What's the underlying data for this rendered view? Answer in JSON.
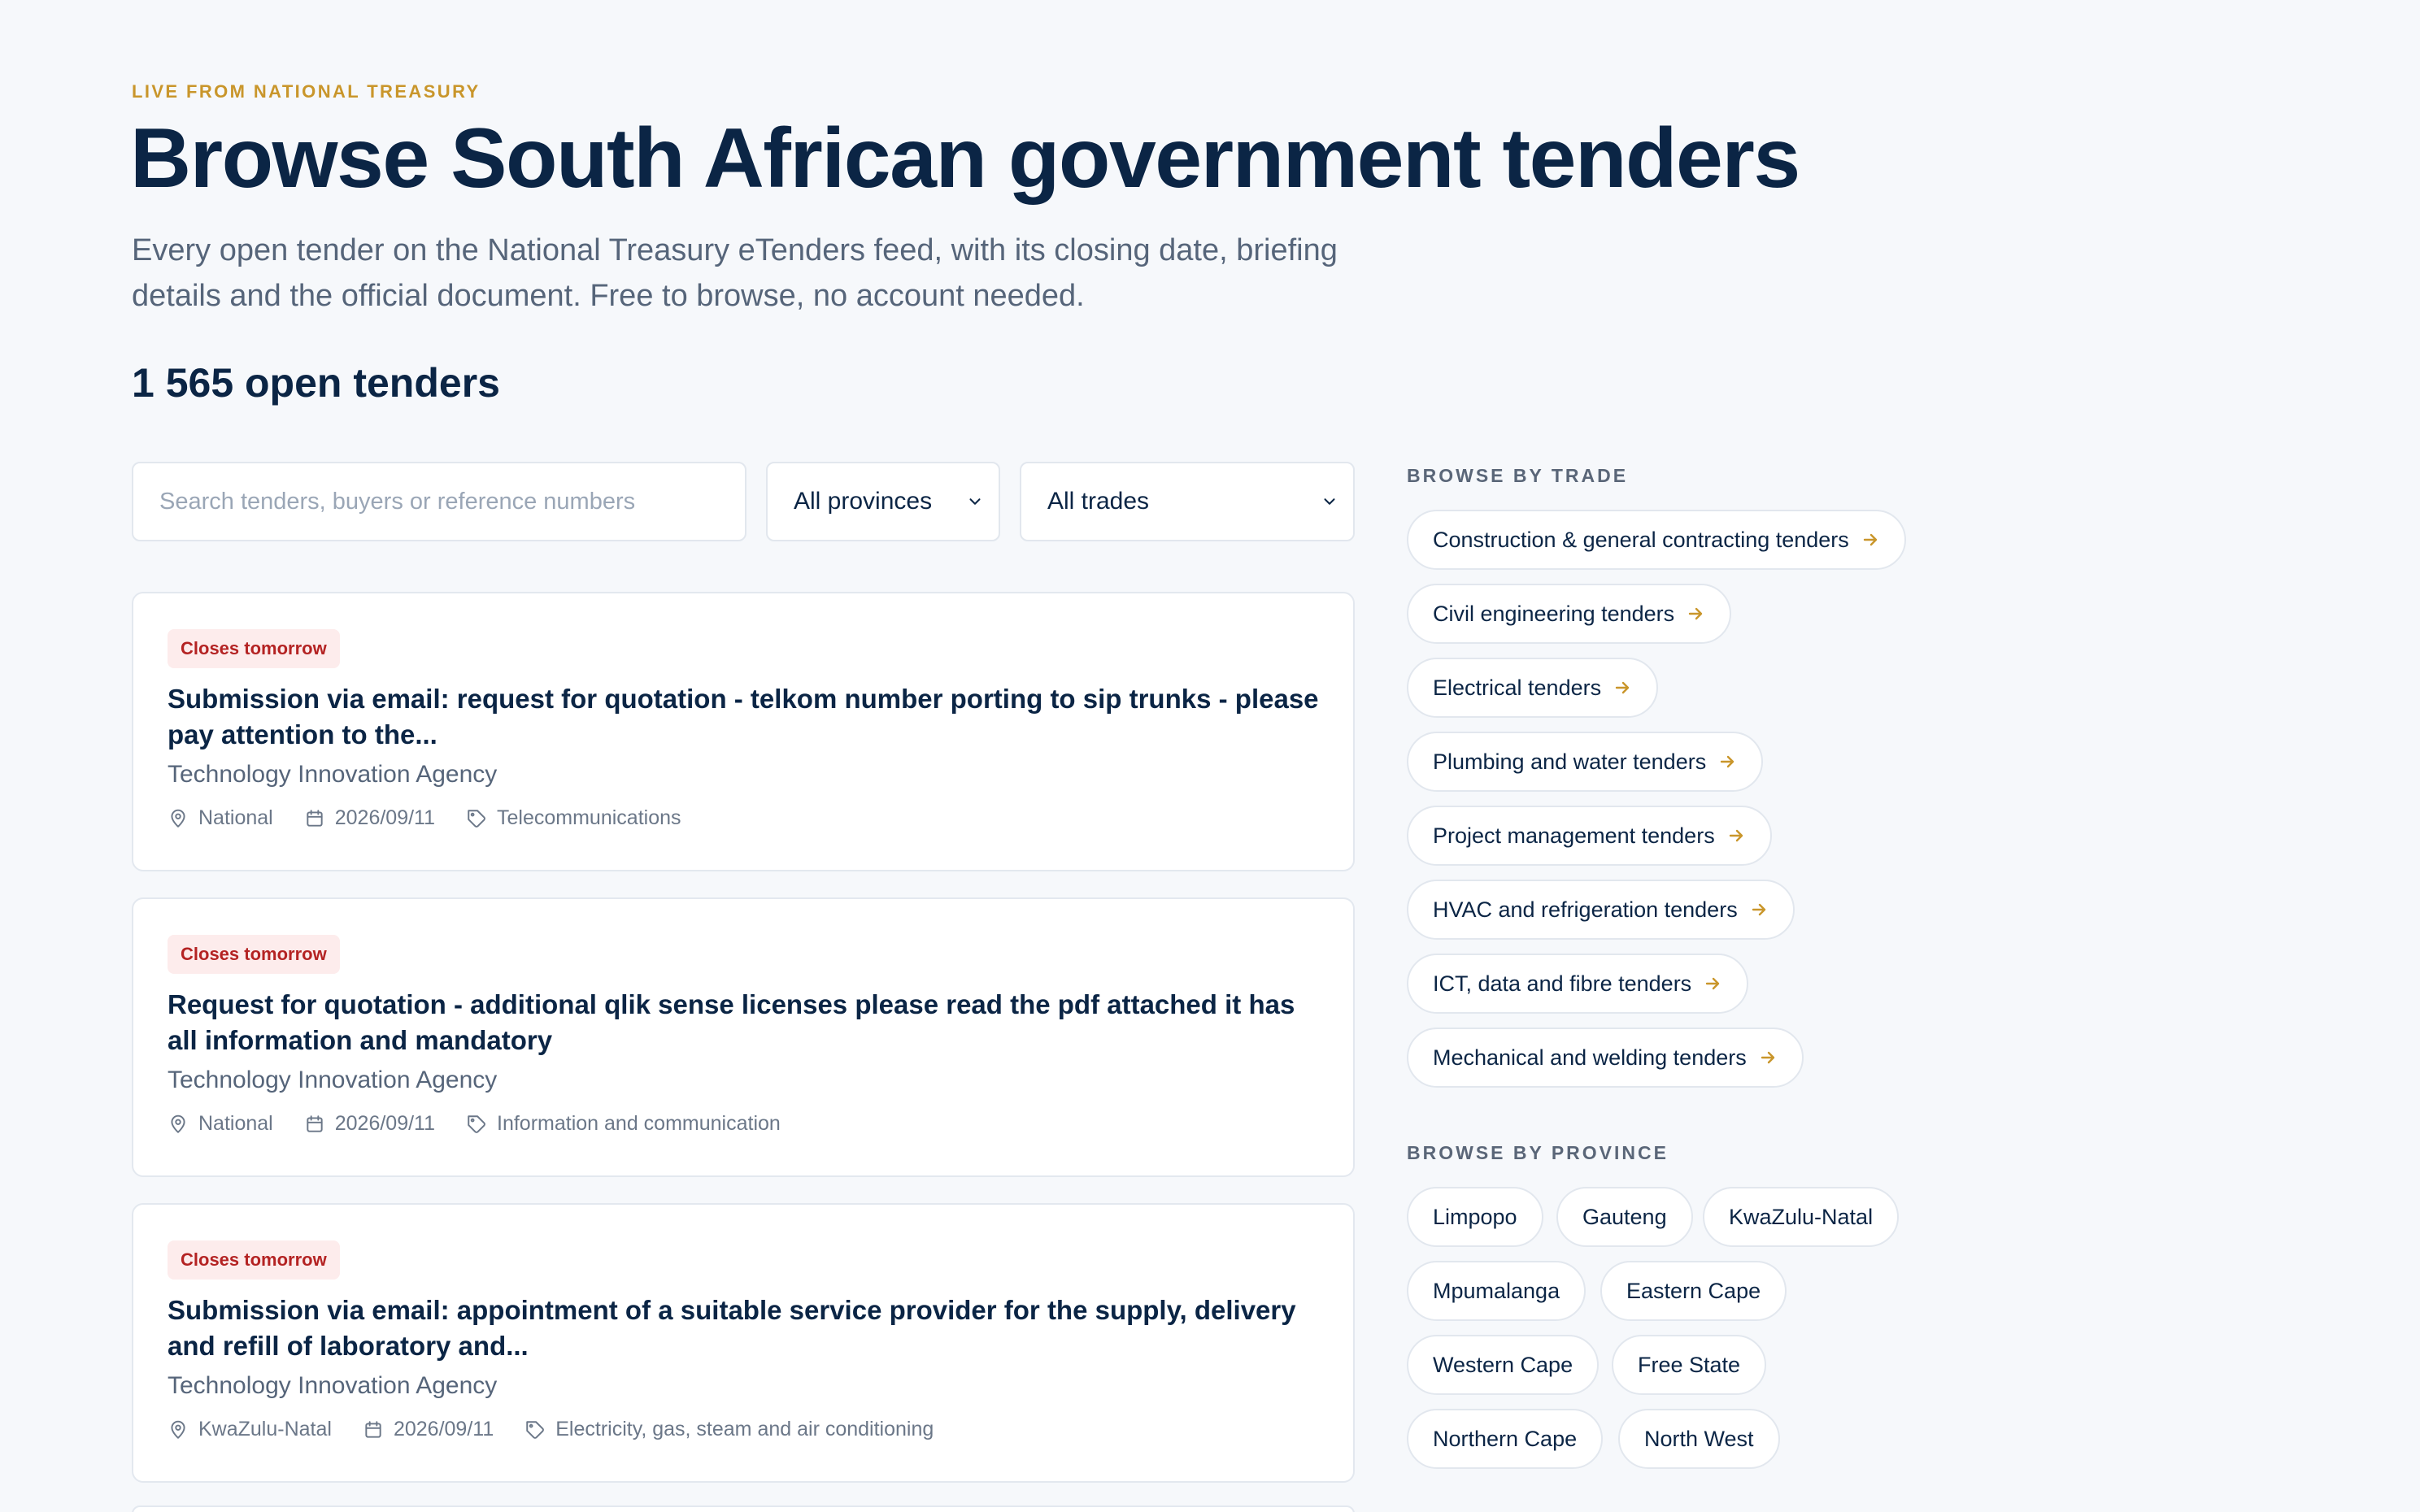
{
  "header": {
    "eyebrow": "LIVE FROM NATIONAL TREASURY",
    "title": "Browse South African government tenders",
    "subtitle": "Every open tender on the National Treasury eTenders feed, with its closing date, briefing details and the official document. Free to browse, no account needed.",
    "count": "1 565 open tenders"
  },
  "filters": {
    "search_placeholder": "Search tenders, buyers or reference numbers",
    "province_value": "All provinces",
    "trade_value": "All trades"
  },
  "tenders": [
    {
      "badge": "Closes tomorrow",
      "title": "Submission via email: request for quotation - telkom number porting to sip trunks - please pay attention to the...",
      "buyer": "Technology Innovation Agency",
      "location": "National",
      "date": "2026/09/11",
      "category": "Telecommunications"
    },
    {
      "badge": "Closes tomorrow",
      "title": "Request for quotation - additional qlik sense licenses please read the pdf attached it has all information and mandatory",
      "buyer": "Technology Innovation Agency",
      "location": "National",
      "date": "2026/09/11",
      "category": "Information and communication"
    },
    {
      "badge": "Closes tomorrow",
      "title": "Submission via email: appointment of a suitable service provider for the supply, delivery and refill of laboratory and...",
      "buyer": "Technology Innovation Agency",
      "location": "KwaZulu-Natal",
      "date": "2026/09/11",
      "category": "Electricity, gas, steam and air conditioning"
    }
  ],
  "sidebar": {
    "trade_heading": "BROWSE BY TRADE",
    "trades": [
      "Construction & general contracting tenders",
      "Civil engineering tenders",
      "Electrical tenders",
      "Plumbing and water tenders",
      "Project management tenders",
      "HVAC and refrigeration tenders",
      "ICT, data and fibre tenders",
      "Mechanical and welding tenders"
    ],
    "province_heading": "BROWSE BY PROVINCE",
    "provinces": [
      "Limpopo",
      "Gauteng",
      "KwaZulu-Natal",
      "Mpumalanga",
      "Eastern Cape",
      "Western Cape",
      "Free State",
      "Northern Cape",
      "North West"
    ]
  },
  "colors": {
    "accent": "#c9962b",
    "navy": "#0b2545",
    "badge_bg": "#fdecec",
    "badge_text": "#b42323"
  }
}
